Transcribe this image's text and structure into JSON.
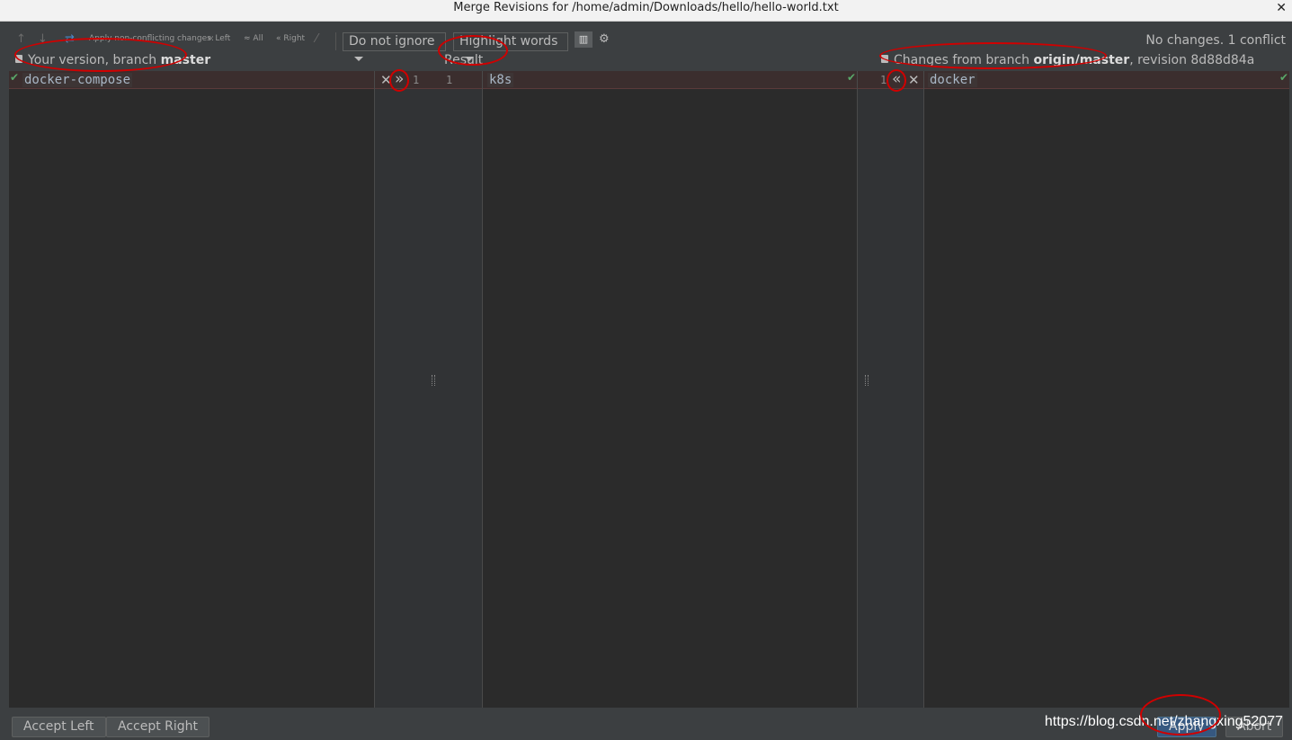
{
  "window": {
    "title": "Merge Revisions for /home/admin/Downloads/hello/hello-world.txt",
    "close_glyph": "✕"
  },
  "toolbar": {
    "apply_non_conflicting": "Apply non-conflicting changes:",
    "left": "Left",
    "all": "All",
    "right": "Right",
    "whitespace_dropdown": "Do not ignore",
    "highlight_dropdown": "Highlight words",
    "status": "No changes. 1 conflict"
  },
  "panels": {
    "left": {
      "prefix": "Your version, branch ",
      "branch": "master",
      "code": "docker-compose"
    },
    "center": {
      "header": "Result",
      "code": "k8s",
      "left_line": "1",
      "right_line": "1"
    },
    "right": {
      "prefix": "Changes from branch ",
      "branch": "origin/master",
      "suffix": ", revision 8d88d84a",
      "code": "docker",
      "line": "1"
    }
  },
  "gutter": {
    "accept_right_glyph": "»",
    "accept_left_glyph": "«",
    "discard_glyph": "✕",
    "check_glyph": "✔"
  },
  "footer": {
    "accept_left": "Accept Left",
    "accept_right": "Accept Right",
    "apply": "Apply",
    "abort": "Abort",
    "watermark": "https://blog.csdn.net/zhangxing52077"
  },
  "colors": {
    "background": "#3c3f41",
    "editor": "#2b2b2b",
    "annotation": "#d00000",
    "check": "#59a869"
  }
}
